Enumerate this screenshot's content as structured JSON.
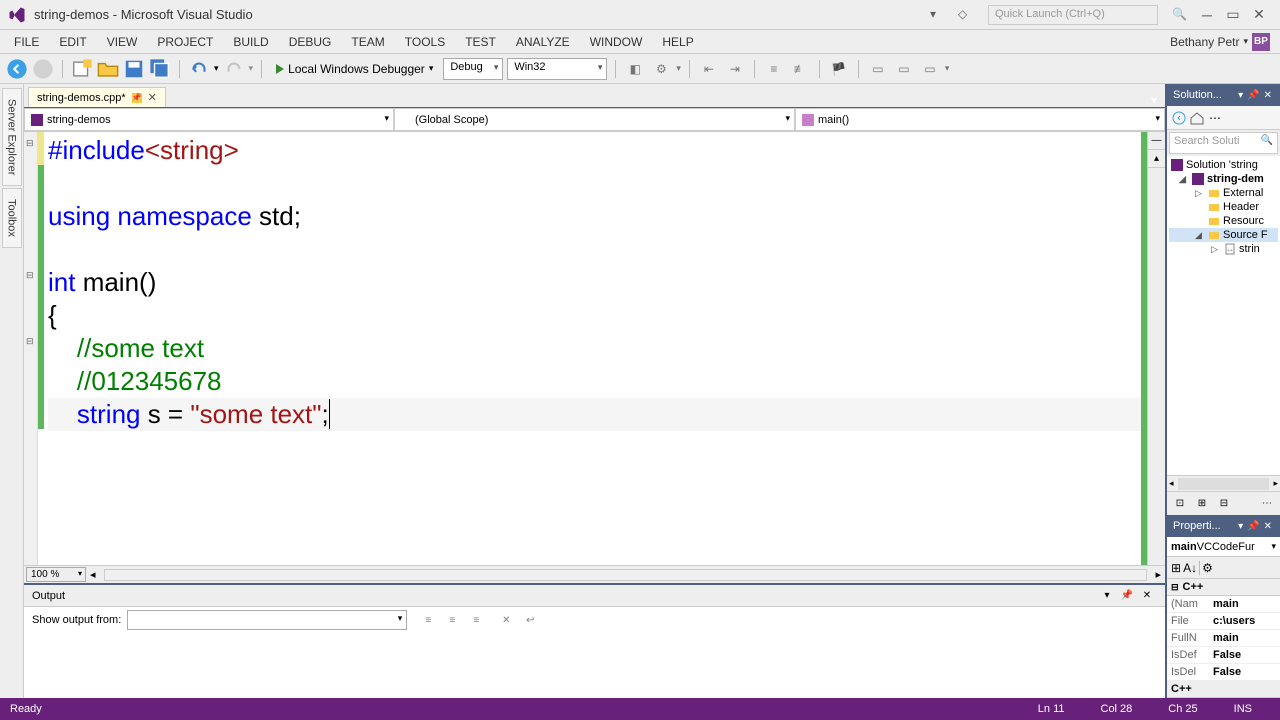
{
  "titlebar": {
    "title": "string-demos - Microsoft Visual Studio",
    "quicklaunch_placeholder": "Quick Launch (Ctrl+Q)"
  },
  "menubar": {
    "items": [
      "FILE",
      "EDIT",
      "VIEW",
      "PROJECT",
      "BUILD",
      "DEBUG",
      "TEAM",
      "TOOLS",
      "TEST",
      "ANALYZE",
      "WINDOW",
      "HELP"
    ],
    "user": "Bethany Petr",
    "badge": "BP"
  },
  "toolbar": {
    "debug_label": "Local Windows Debugger",
    "config": "Debug",
    "platform": "Win32"
  },
  "sidebar_tabs": [
    "Server Explorer",
    "Toolbox"
  ],
  "editor": {
    "tab_name": "string-demos.cpp*",
    "nav_project": "string-demos",
    "nav_scope": "(Global Scope)",
    "nav_function": "main()",
    "zoom": "100 %",
    "code_lines": [
      {
        "tokens": [
          [
            "kw",
            "#include"
          ],
          [
            "str",
            "<string>"
          ]
        ]
      },
      {
        "tokens": []
      },
      {
        "tokens": [
          [
            "kw",
            "using"
          ],
          [
            "txt",
            " "
          ],
          [
            "kw",
            "namespace"
          ],
          [
            "txt",
            " std;"
          ]
        ]
      },
      {
        "tokens": []
      },
      {
        "tokens": [
          [
            "kw",
            "int"
          ],
          [
            "txt",
            " main()"
          ]
        ]
      },
      {
        "tokens": [
          [
            "txt",
            "{"
          ]
        ]
      },
      {
        "tokens": [
          [
            "txt",
            "    "
          ],
          [
            "cmt",
            "//some text"
          ]
        ]
      },
      {
        "tokens": [
          [
            "txt",
            "    "
          ],
          [
            "cmt",
            "//012345678"
          ]
        ]
      },
      {
        "tokens": [
          [
            "txt",
            "    "
          ],
          [
            "kw",
            "string"
          ],
          [
            "txt",
            " s = "
          ],
          [
            "str",
            "\"some text\""
          ],
          [
            "txt",
            ";"
          ]
        ],
        "current": true
      }
    ]
  },
  "output": {
    "title": "Output",
    "show_label": "Show output from:"
  },
  "solution_explorer": {
    "title": "Solution...",
    "search_placeholder": "Search Soluti",
    "tree": {
      "root": "Solution 'string",
      "project": "string-dem",
      "folders": [
        "External",
        "Header",
        "Resourc",
        "Source F"
      ],
      "file": "strin"
    }
  },
  "properties": {
    "title": "Properti...",
    "subheader_name": "main",
    "subheader_type": " VCCodeFur",
    "category": "C++",
    "rows": [
      {
        "name": "(Nam",
        "value": "main"
      },
      {
        "name": "File",
        "value": "c:\\users"
      },
      {
        "name": "FullN",
        "value": "main"
      },
      {
        "name": "IsDef",
        "value": "False"
      },
      {
        "name": "IsDel",
        "value": "False"
      }
    ],
    "category2": "C++"
  },
  "statusbar": {
    "status": "Ready",
    "line": "Ln 11",
    "col": "Col 28",
    "ch": "Ch 25",
    "ins": "INS"
  }
}
